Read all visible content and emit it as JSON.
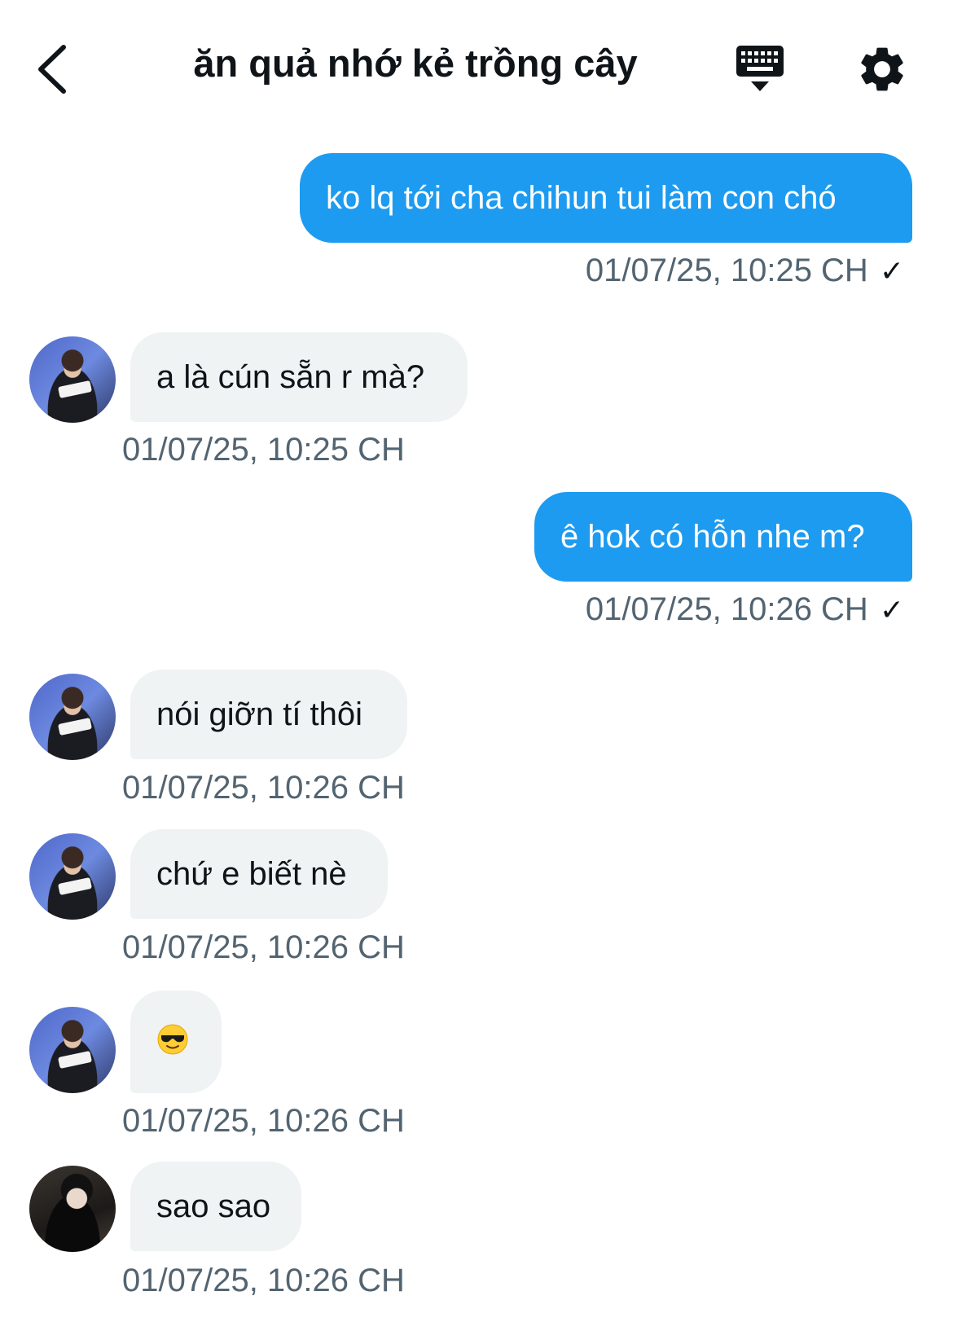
{
  "header": {
    "title": "ăn quả nhớ kẻ trồng cây",
    "back_icon": "chevron-left-icon",
    "keyboard_icon": "keyboard-icon",
    "settings_icon": "gear-icon"
  },
  "colors": {
    "outgoing_bubble": "#1d9bf0",
    "incoming_bubble": "#eff3f4",
    "timestamp": "#536471"
  },
  "messages": [
    {
      "direction": "out",
      "text": "ko lq tới cha chihun tui làm con chó",
      "timestamp": "01/07/25, 10:25 CH",
      "status": "✓"
    },
    {
      "direction": "in",
      "text": "a là cún sẵn r mà?",
      "timestamp": "01/07/25, 10:25 CH"
    },
    {
      "direction": "out",
      "text": "ê hok có hỗn nhe m?",
      "timestamp": "01/07/25, 10:26 CH",
      "status": "✓"
    },
    {
      "direction": "in",
      "text": "nói giỡn tí thôi",
      "timestamp": "01/07/25, 10:26 CH"
    },
    {
      "direction": "in",
      "text": "chứ e biết nè",
      "timestamp": "01/07/25, 10:26 CH"
    },
    {
      "direction": "in",
      "text": "",
      "emoji": "smiling-face-with-sunglasses",
      "timestamp": "01/07/25, 10:26 CH"
    },
    {
      "direction": "in",
      "text": "sao sao",
      "timestamp": "01/07/25, 10:26 CH"
    }
  ]
}
